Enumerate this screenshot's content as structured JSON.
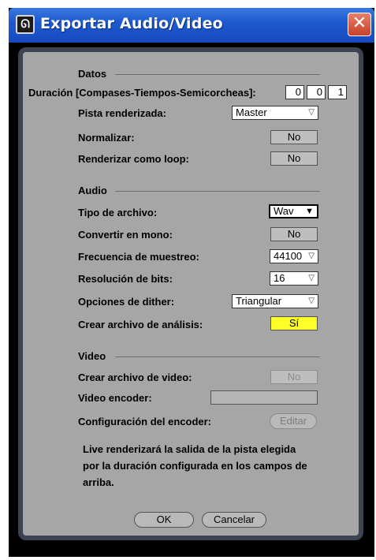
{
  "window": {
    "title": "Exportar Audio/Video",
    "close_symbol": "✕"
  },
  "datos": {
    "header": "Datos",
    "duracion_label": "Duración [Compases-Tiempos-Semicorcheas]:",
    "duracion_values": [
      "0",
      "0",
      "1"
    ],
    "pista_label": "Pista renderizada:",
    "pista_value": "Master",
    "normalizar_label": "Normalizar:",
    "normalizar_value": "No",
    "loop_label": "Renderizar como loop:",
    "loop_value": "No"
  },
  "audio": {
    "header": "Audio",
    "tipo_label": "Tipo de archivo:",
    "tipo_value": "Wav",
    "mono_label": "Convertir en mono:",
    "mono_value": "No",
    "frecuencia_label": "Frecuencia de muestreo:",
    "frecuencia_value": "44100",
    "bits_label": "Resolución de bits:",
    "bits_value": "16",
    "dither_label": "Opciones de dither:",
    "dither_value": "Triangular",
    "analisis_label": "Crear archivo de análisis:",
    "analisis_value": "Sí"
  },
  "video": {
    "header": "Video",
    "crear_label": "Crear archivo de video:",
    "crear_value": "No",
    "encoder_label": "Video encoder:",
    "encoder_value": "",
    "config_label": "Configuración del encoder:",
    "config_button": "Editar"
  },
  "note": {
    "line1": "Live renderizará la salida de la pista elegida",
    "line2": "por la duración configurada en los campos de",
    "line3": "arriba."
  },
  "buttons": {
    "ok": "OK",
    "cancel": "Cancelar"
  }
}
